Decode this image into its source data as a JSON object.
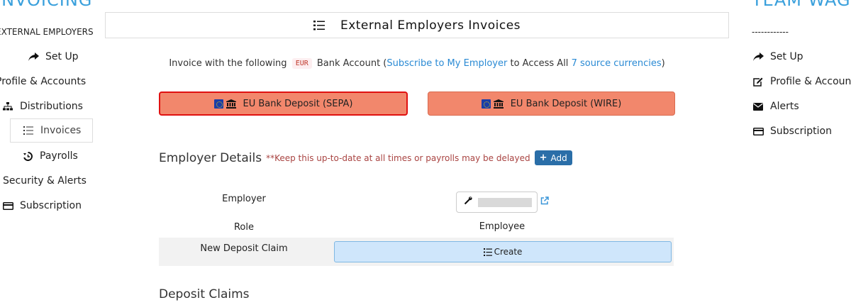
{
  "brand": {
    "left": "INVOICING",
    "right": "TEAM WAG"
  },
  "left_nav": {
    "heading": "EXTERNAL EMPLOYERS",
    "items": [
      {
        "label": "Set Up",
        "icon": "share-arrow-icon"
      },
      {
        "label": "Profile & Accounts",
        "icon": "none"
      },
      {
        "label": "Distributions",
        "icon": "sitemap-icon"
      },
      {
        "label": "Invoices",
        "icon": "list-icon",
        "active": true
      },
      {
        "label": "Payrolls",
        "icon": "history-icon"
      },
      {
        "label": "Security & Alerts",
        "icon": "none"
      },
      {
        "label": "Subscription",
        "icon": "credit-card-icon"
      }
    ]
  },
  "right_nav": {
    "separator": "------------",
    "items": [
      {
        "label": "Set Up",
        "icon": "share-arrow-icon"
      },
      {
        "label": "Profile & Accounts",
        "icon": "edit-icon"
      },
      {
        "label": "Alerts",
        "icon": "envelope-icon"
      },
      {
        "label": "Subscription",
        "icon": "credit-card-icon"
      }
    ]
  },
  "page": {
    "title": "External Employers Invoices",
    "invoice_prefix": "Invoice with the following",
    "currency": "EUR",
    "bank_account_text": "Bank Account (",
    "subscribe_link": "Subscribe to My Employer",
    "access_text": "to Access All",
    "currencies_link": "7 source currencies",
    "close_paren": ")"
  },
  "bank_buttons": [
    {
      "label": "EU Bank Deposit (SEPA)",
      "selected": true
    },
    {
      "label": "EU Bank Deposit (WIRE)",
      "selected": false
    }
  ],
  "employer_details": {
    "heading": "Employer Details",
    "warning": "**Keep this up-to-date at all times or payrolls may be delayed",
    "add_label": "Add",
    "employer_label": "Employer",
    "role_label": "Role",
    "role_value": "Employee",
    "claim_label": "New Deposit Claim",
    "create_label": "Create"
  },
  "deposit_claims_heading": "Deposit Claims",
  "colors": {
    "accent_blue": "#3aa0dc",
    "bank_button": "#f2876c",
    "selected_border": "#e01111",
    "add_button": "#2a6ea8",
    "create_button": "#cfe6fb"
  }
}
